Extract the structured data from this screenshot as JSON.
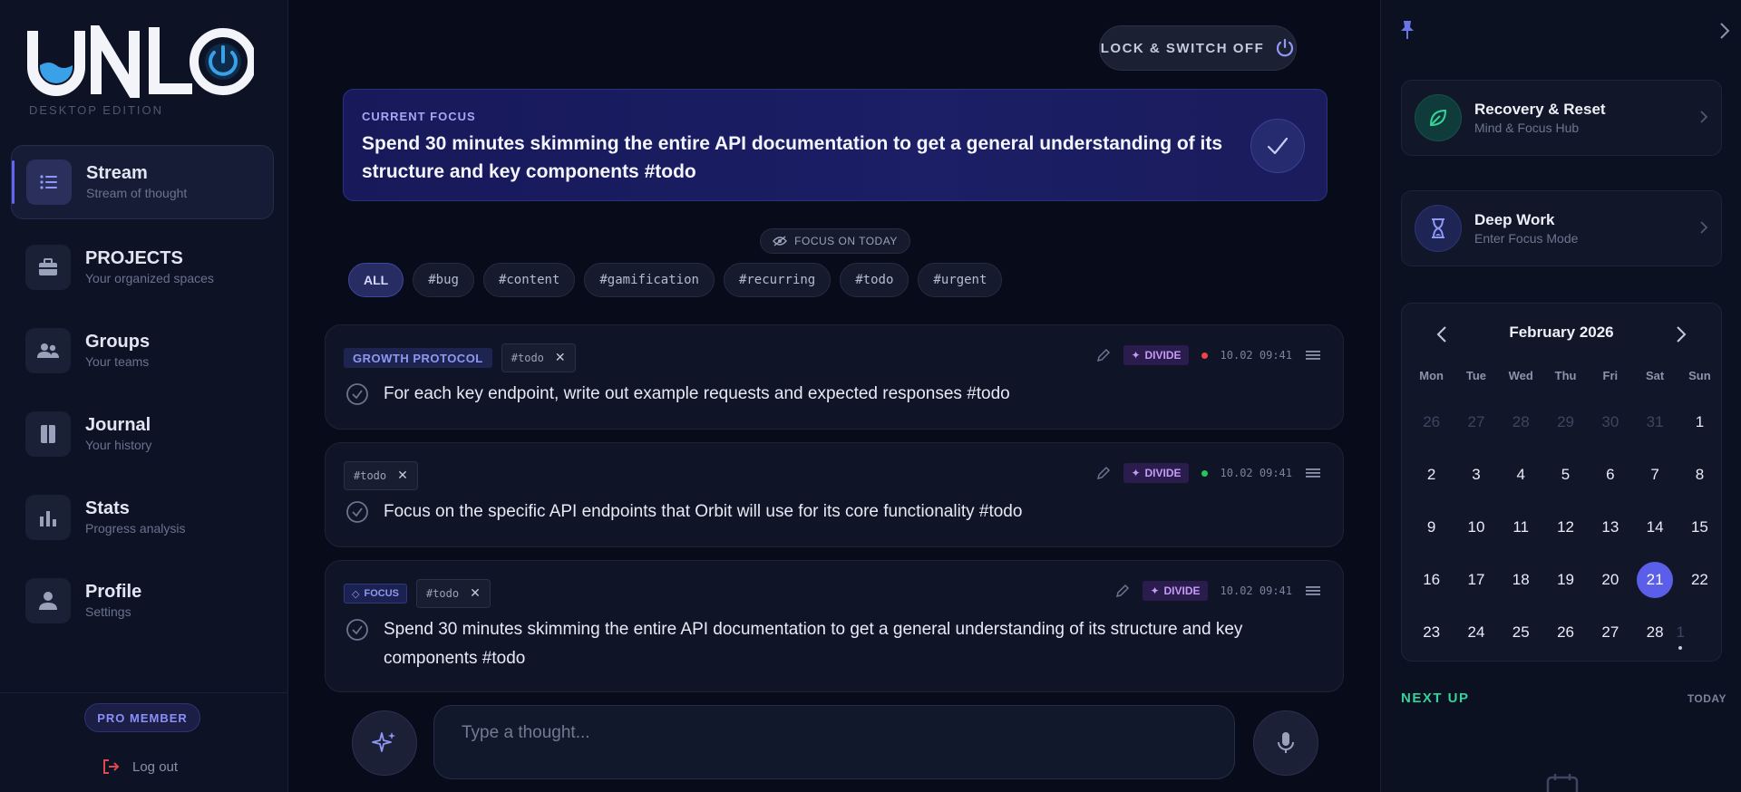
{
  "brand": {
    "logo_text": "UNL",
    "edition": "DESKTOP EDITION"
  },
  "sidebar": {
    "items": [
      {
        "title": "Stream",
        "subtitle": "Stream of thought"
      },
      {
        "title": "PROJECTS",
        "subtitle": "Your organized spaces"
      },
      {
        "title": "Groups",
        "subtitle": "Your teams"
      },
      {
        "title": "Journal",
        "subtitle": "Your history"
      },
      {
        "title": "Stats",
        "subtitle": "Progress analysis"
      },
      {
        "title": "Profile",
        "subtitle": "Settings"
      }
    ],
    "pro_badge": "PRO MEMBER",
    "logout": "Log out"
  },
  "header": {
    "lock_label": "LOCK & SWITCH OFF"
  },
  "current_focus": {
    "label": "CURRENT FOCUS",
    "text": "Spend 30 minutes skimming the entire API documentation to get a general understanding of its structure and key components #todo"
  },
  "focus_today": "FOCUS ON TODAY",
  "filters": [
    "ALL",
    "#bug",
    "#content",
    "#gamification",
    "#recurring",
    "#todo",
    "#urgent"
  ],
  "tasks": [
    {
      "protocol": "GROWTH PROTOCOL",
      "tag": "#todo",
      "action": "DIVIDE",
      "status_color": "#ef4444",
      "time": "10.02 09:41",
      "text": "For each key endpoint, write out example requests and expected responses #todo"
    },
    {
      "tag": "#todo",
      "action": "DIVIDE",
      "status_color": "#22c55e",
      "time": "10.02 09:41",
      "text": "Focus on the specific API endpoints that Orbit will use for its core functionality #todo"
    },
    {
      "focus_badge": "FOCUS",
      "tag": "#todo",
      "action": "DIVIDE",
      "time": "10.02 09:41",
      "text": "Spend 30 minutes skimming the entire API documentation to get a general understanding of its structure and key components #todo"
    }
  ],
  "composer": {
    "placeholder": "Type a thought..."
  },
  "right_panel": {
    "cards": [
      {
        "title": "Recovery & Reset",
        "subtitle": "Mind & Focus Hub",
        "icon": "leaf-icon"
      },
      {
        "title": "Deep Work",
        "subtitle": "Enter Focus Mode",
        "icon": "hourglass-icon"
      }
    ],
    "calendar": {
      "month": "February 2026",
      "weekdays": [
        "Mon",
        "Tue",
        "Wed",
        "Thu",
        "Fri",
        "Sat",
        "Sun"
      ],
      "days": [
        "26",
        "27",
        "28",
        "29",
        "30",
        "31",
        "1",
        "2",
        "3",
        "4",
        "5",
        "6",
        "7",
        "8",
        "9",
        "10",
        "11",
        "12",
        "13",
        "14",
        "15",
        "16",
        "17",
        "18",
        "19",
        "20",
        "21",
        "22",
        "23",
        "24",
        "25",
        "26",
        "27",
        "28",
        "1"
      ],
      "selected": "21"
    },
    "next_up": "NEXT UP",
    "today": "TODAY"
  },
  "colors": {
    "accent": "#6366f1",
    "next_up": "#34d399",
    "divide": "#c59bf5"
  }
}
